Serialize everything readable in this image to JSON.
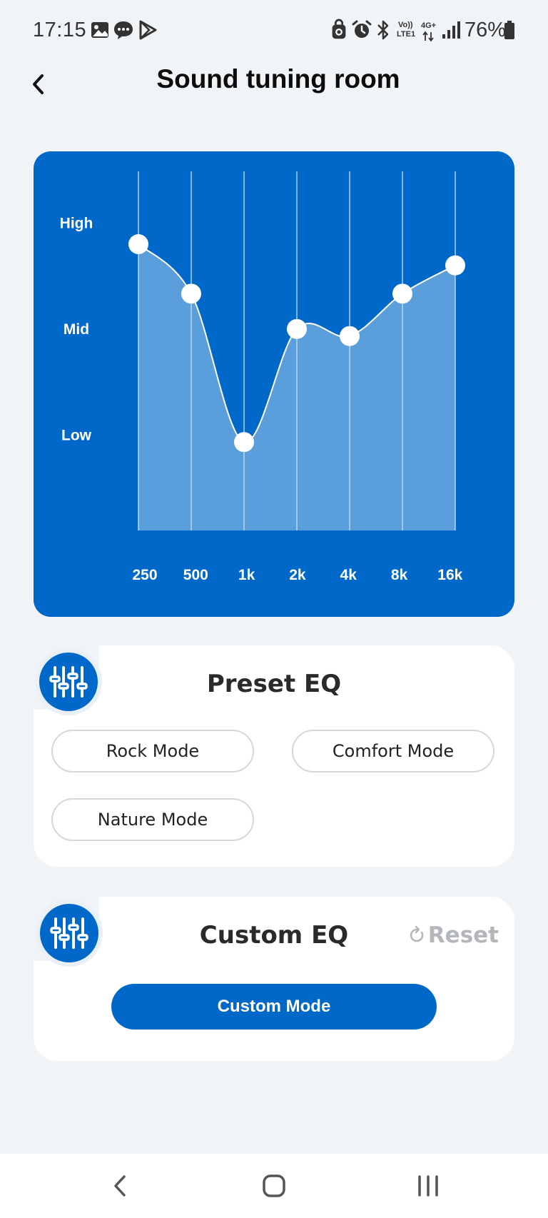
{
  "status_bar": {
    "time": "17:15",
    "battery_percent": "76%",
    "network_top": "Vo))",
    "network_bottom": "LTE1",
    "data_type": "4G+"
  },
  "header": {
    "title": "Sound tuning room"
  },
  "eq_chart": {
    "y_labels": [
      "High",
      "Mid",
      "Low"
    ],
    "fill_color": "#5a9edb",
    "background_color": "#0068c8"
  },
  "chart_data": {
    "type": "line",
    "x": [
      "250",
      "500",
      "1k",
      "2k",
      "4k",
      "8k",
      "16k"
    ],
    "y_tick_labels": [
      "High",
      "Mid",
      "Low"
    ],
    "y_tick_values": [
      8,
      5,
      2
    ],
    "ylim": [
      -0.7,
      9.4
    ],
    "values": [
      7.4,
      6.0,
      1.8,
      5.0,
      4.8,
      6.0,
      6.8
    ],
    "smooth": true,
    "filled": true,
    "grid": "vertical"
  },
  "preset_eq": {
    "title": "Preset EQ",
    "modes": [
      "Rock Mode",
      "Comfort Mode",
      "Nature Mode"
    ]
  },
  "custom_eq": {
    "title": "Custom EQ",
    "reset_label": "Reset",
    "custom_mode_label": "Custom Mode"
  },
  "colors": {
    "accent": "#0068c8",
    "background": "#f1f4f6",
    "reset_gray": "#b3b6ba"
  }
}
